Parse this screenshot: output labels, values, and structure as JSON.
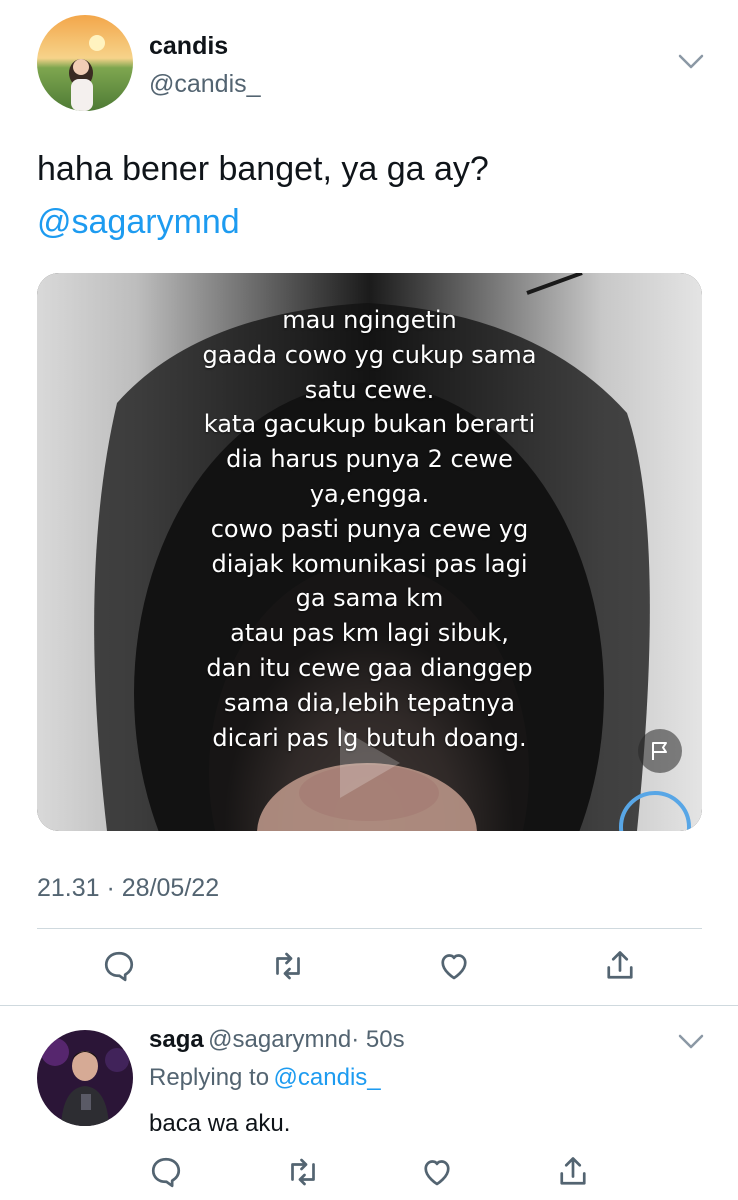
{
  "tweet": {
    "author_name": "candis",
    "author_handle": "@candis_",
    "text": "haha bener banget, ya ga ay?",
    "mention": "@sagarymnd",
    "media_overlay_text": "mau ngingetin\ngaada cowo yg cukup sama\nsatu cewe.\nkata gacukup bukan berarti\ndia harus punya 2 cewe\nya,engga.\ncowo pasti punya cewe yg\ndiajak komunikasi pas lagi\nga sama km\natau pas km lagi sibuk,\ndan itu cewe gaa dianggep\nsama dia,lebih tepatnya\ndicari pas lg butuh doang.",
    "timestamp": "21.31 · 28/05/22"
  },
  "reply": {
    "author_name": "saga",
    "author_handle": "@sagarymnd",
    "time": "· 50s",
    "replying_label": "Replying to",
    "replying_to": "@candis_",
    "text": "baca wa aku."
  },
  "icons": {
    "reply": "comment-icon",
    "retweet": "retweet-icon",
    "like": "heart-icon",
    "share": "share-icon",
    "more": "chevron-down-icon",
    "report": "flag-icon"
  },
  "colors": {
    "link": "#1d9bf0",
    "secondary_text": "#536471",
    "divider": "#cfd9de"
  }
}
